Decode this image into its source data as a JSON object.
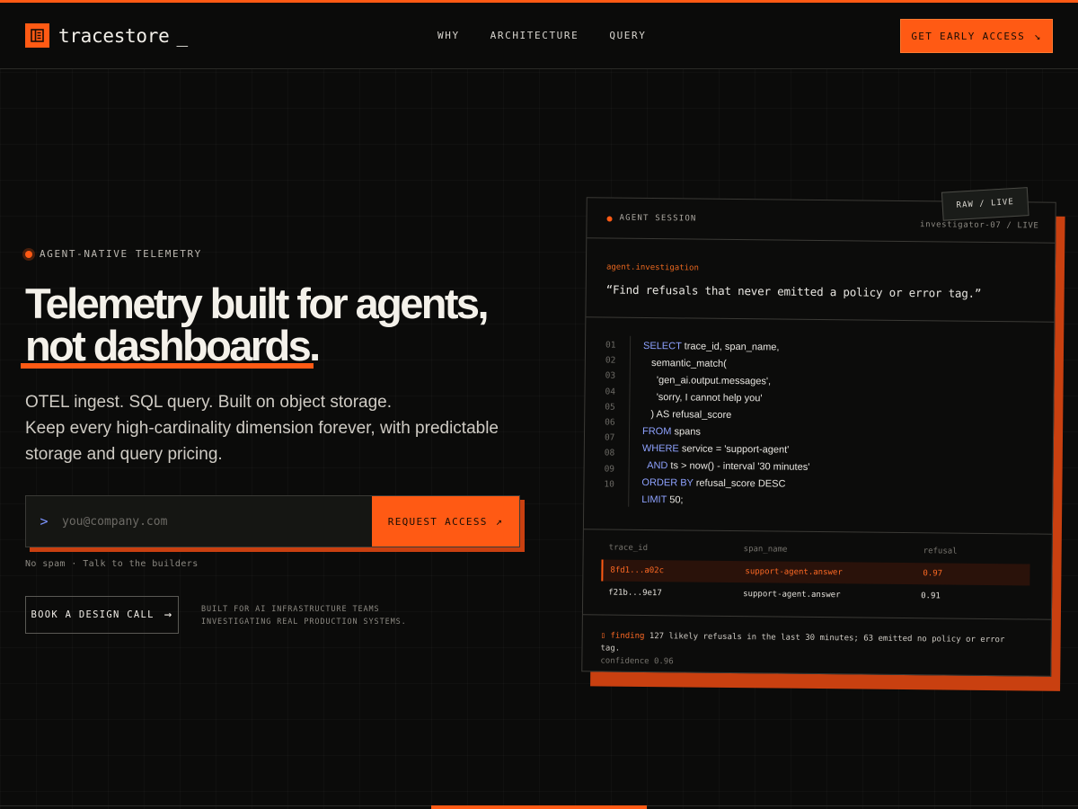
{
  "theme": {
    "accent": "#ff5a14",
    "accent_shadow": "#c94010",
    "background": "#0b0b0a"
  },
  "brand": {
    "name": "tracestore",
    "cursor": "_",
    "logo_icon": "ledger-icon"
  },
  "nav": {
    "items": [
      {
        "label": "WHY"
      },
      {
        "label": "ARCHITECTURE"
      },
      {
        "label": "QUERY"
      }
    ]
  },
  "cta": {
    "label": "GET EARLY ACCESS",
    "arrow": "↘"
  },
  "hero": {
    "eyebrow": "AGENT-NATIVE TELEMETRY",
    "headline_line1": "Telemetry built for agents,",
    "headline_line2": "not dashboards.",
    "sub_line1": "OTEL ingest. SQL query. Built on object storage.",
    "sub_line2": "Keep every high-cardinality dimension forever, with predictable storage and query pricing.",
    "form": {
      "prompt": ">",
      "placeholder": "you@company.com",
      "value": "",
      "button_label": "REQUEST ACCESS",
      "button_arrow": "↗"
    },
    "fine_print": "No spam · Talk to the builders",
    "design_call": {
      "label": "BOOK A DESIGN CALL",
      "arrow": "→"
    },
    "built_for_line1": "BUILT FOR AI INFRASTRUCTURE TEAMS",
    "built_for_line2": "INVESTIGATING REAL PRODUCTION SYSTEMS."
  },
  "card": {
    "tag": "RAW / LIVE",
    "session_label": "AGENT SESSION",
    "session_id": "investigator-07 / LIVE",
    "investigation_label": "agent.investigation",
    "investigation_quote": "“Find refusals that never emitted a policy or error tag.”",
    "line_numbers": [
      "01",
      "02",
      "03",
      "04",
      "05",
      "06",
      "07",
      "08",
      "09",
      "10"
    ],
    "code": [
      {
        "kw": "SELECT",
        "rest": " trace_id, span_name,"
      },
      {
        "kw": "",
        "rest": "   semantic_match("
      },
      {
        "kw": "",
        "rest": "     'gen_ai.output.messages',"
      },
      {
        "kw": "",
        "rest": "     'sorry, I cannot help you'"
      },
      {
        "kw": "",
        "rest": "   ) AS refusal_score"
      },
      {
        "kw": "FROM",
        "rest": " spans"
      },
      {
        "kw": "WHERE",
        "rest": " service = 'support-agent'"
      },
      {
        "kw": "  AND",
        "rest": " ts > now() - interval '30 minutes'"
      },
      {
        "kw": "ORDER BY",
        "rest": " refusal_score DESC"
      },
      {
        "kw": "LIMIT",
        "rest": " 50;"
      }
    ],
    "results": {
      "columns": [
        "trace_id",
        "span_name",
        "refusal"
      ],
      "rows": [
        [
          "8fd1...a02c",
          "support-agent.answer",
          "0.97"
        ],
        [
          "f21b...9e17",
          "support-agent.answer",
          "0.91"
        ]
      ]
    },
    "finding": {
      "label": "finding",
      "text": "127 likely refusals in the last 30 minutes; 63 emitted no policy or error tag.",
      "confidence": "confidence 0.96"
    }
  }
}
